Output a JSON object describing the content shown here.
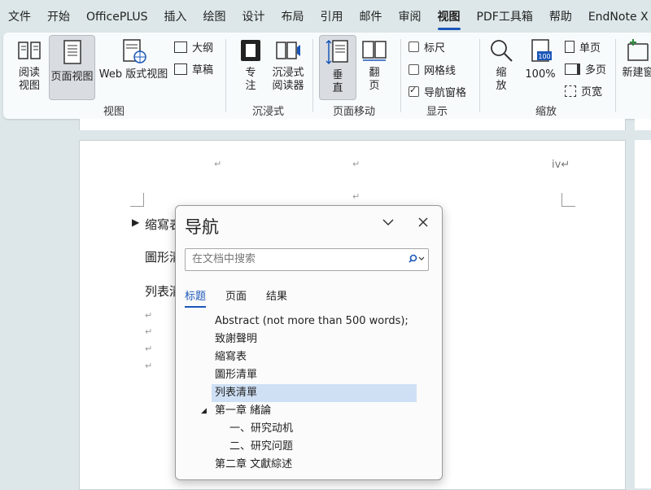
{
  "menu": [
    "文件",
    "开始",
    "OfficePLUS",
    "插入",
    "绘图",
    "设计",
    "布局",
    "引用",
    "邮件",
    "审阅",
    "视图",
    "PDF工具箱",
    "帮助",
    "EndNote X"
  ],
  "active_menu": "视图",
  "ribbon": {
    "read_view": "阅读视图",
    "read_view_l1": "阅读",
    "read_view_l2": "视图",
    "page_view": "页面视图",
    "web_view": "Web 版式视图",
    "outline": "大纲",
    "draft": "草稿",
    "group_view": "视图",
    "focus_l1": "专",
    "focus_l2": "注",
    "immersive_l1": "沉浸式",
    "immersive_l2": "阅读器",
    "group_immersive": "沉浸式",
    "vertical_l1": "垂",
    "vertical_l2": "直",
    "flip_l1": "翻",
    "flip_l2": "页",
    "group_page_move": "页面移动",
    "ruler": "标尺",
    "gridlines": "网格线",
    "nav_pane": "导航窗格",
    "group_show": "显示",
    "zoom_l1": "缩",
    "zoom_l2": "放",
    "zoom_100": "100%",
    "one_page": "单页",
    "multi_page": "多页",
    "page_width": "页宽",
    "group_zoom": "缩放",
    "new_window": "新建窗",
    "checkboxes": {
      "ruler": false,
      "gridlines": false,
      "nav_pane": true
    }
  },
  "document": {
    "header_mark": "iv",
    "lines": [
      "缩寫表",
      "圖形清",
      "列表清"
    ]
  },
  "nav": {
    "title": "导航",
    "search_placeholder": "在文档中搜索",
    "tabs": [
      "标题",
      "页面",
      "结果"
    ],
    "active_tab": "标题",
    "items": [
      {
        "label": "Abstract  (not more than 500 words);",
        "level": 1,
        "selected": false
      },
      {
        "label": "致謝聲明",
        "level": 1,
        "selected": false
      },
      {
        "label": "縮寫表",
        "level": 1,
        "selected": false
      },
      {
        "label": "圖形清單",
        "level": 1,
        "selected": false
      },
      {
        "label": "列表清單",
        "level": 1,
        "selected": true
      },
      {
        "label": "第一章 緒論",
        "level": 1,
        "selected": false,
        "expanded": true
      },
      {
        "label": "一、研究动机",
        "level": 2,
        "selected": false
      },
      {
        "label": "二、研究问题",
        "level": 2,
        "selected": false
      },
      {
        "label": "第二章 文獻綜述",
        "level": 1,
        "selected": false
      }
    ]
  },
  "colors": {
    "accent": "#1b57b8",
    "selection": "#cfe0f5",
    "background": "#dde7e9"
  }
}
